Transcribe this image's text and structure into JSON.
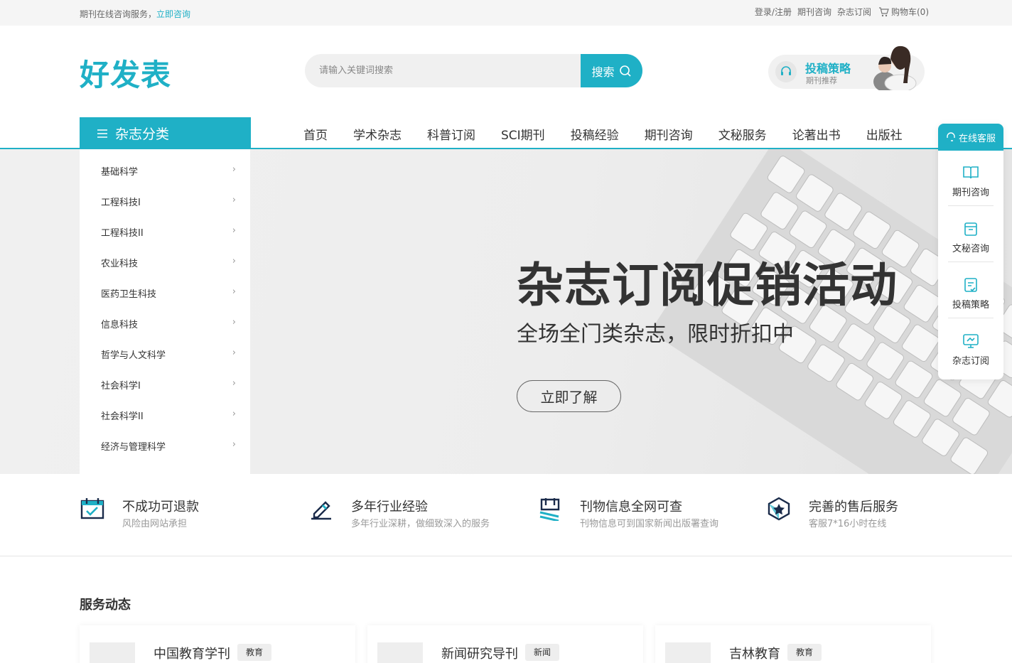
{
  "topbar": {
    "service_text": "期刊在线咨询服务，",
    "consult_link": "立即咨询",
    "links": [
      "登录/注册",
      "期刊咨询",
      "杂志订阅"
    ],
    "cart": "购物车(0)"
  },
  "header": {
    "logo": "好发表",
    "search_placeholder": "请输入关键词搜索",
    "search_button": "搜索",
    "promo_title": "投稿策略",
    "promo_sub": "期刊推荐"
  },
  "nav": {
    "category_label": "杂志分类",
    "items": [
      "首页",
      "学术杂志",
      "科普订阅",
      "SCI期刊",
      "投稿经验",
      "期刊咨询",
      "文秘服务",
      "论著出书",
      "出版社"
    ]
  },
  "sidemenu": {
    "items": [
      "基础科学",
      "工程科技I",
      "工程科技II",
      "农业科技",
      "医药卫生科技",
      "信息科技",
      "哲学与人文科学",
      "社会科学I",
      "社会科学II",
      "经济与管理科学"
    ]
  },
  "hero": {
    "title": "杂志订阅促销活动",
    "subtitle": "全场全门类杂志，限时折扣中",
    "button": "立即了解"
  },
  "float": {
    "head": "在线客服",
    "items": [
      "期刊咨询",
      "文秘咨询",
      "投稿策略",
      "杂志订阅"
    ]
  },
  "features": [
    {
      "title": "不成功可退款",
      "desc": "风险由网站承担"
    },
    {
      "title": "多年行业经验",
      "desc": "多年行业深耕，做细致深入的服务"
    },
    {
      "title": "刊物信息全网可查",
      "desc": "刊物信息可到国家新闻出版署查询"
    },
    {
      "title": "完善的售后服务",
      "desc": "客服7*16小时在线"
    }
  ],
  "section": {
    "title": "服务动态",
    "cards": [
      {
        "name": "中国教育学刊",
        "tag": "教育"
      },
      {
        "name": "新闻研究导刊",
        "tag": "新闻"
      },
      {
        "name": "吉林教育",
        "tag": "教育"
      }
    ]
  },
  "colors": {
    "accent": "#1fb0c6"
  }
}
